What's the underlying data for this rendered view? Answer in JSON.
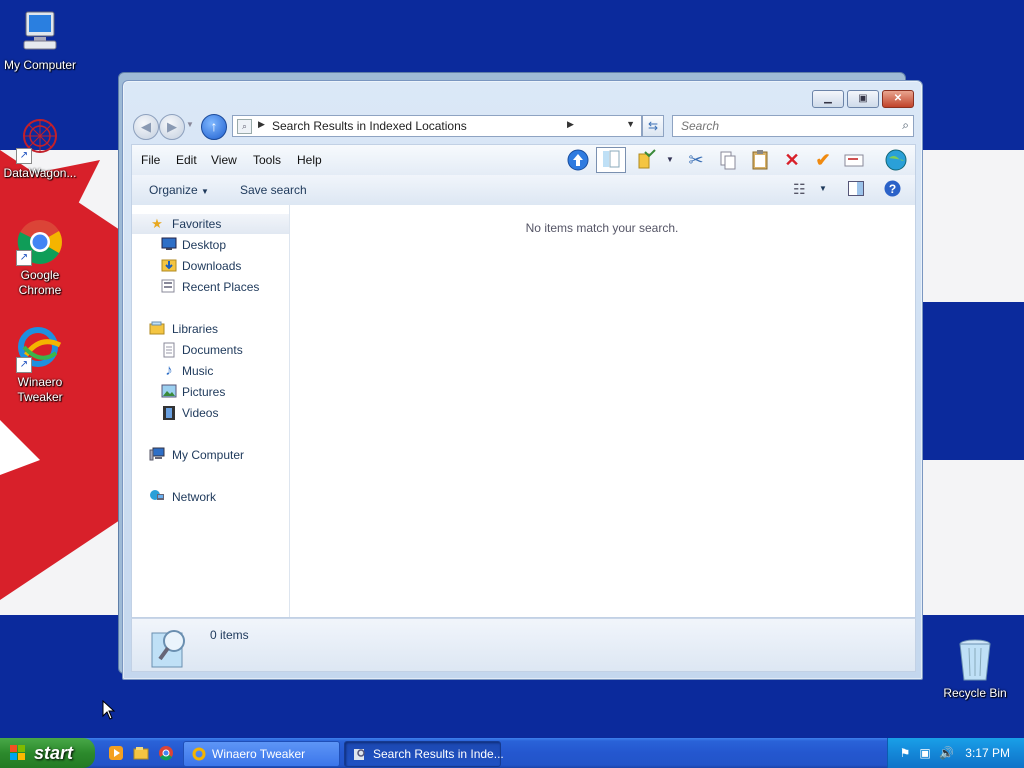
{
  "desktop": {
    "icons": [
      {
        "label": "My Computer"
      },
      {
        "label": "DataWagon..."
      },
      {
        "label": "Google Chrome"
      },
      {
        "label": "Winaero Tweaker"
      },
      {
        "label": "Recycle Bin"
      }
    ]
  },
  "window": {
    "address": {
      "crumb": "Search Results in Indexed Locations"
    },
    "search": {
      "placeholder": "Search"
    },
    "menus": [
      "File",
      "Edit",
      "View",
      "Tools",
      "Help"
    ],
    "commands": {
      "organize": "Organize",
      "save_search": "Save search"
    },
    "nav": {
      "favorites": "Favorites",
      "desktop": "Desktop",
      "downloads": "Downloads",
      "recent": "Recent Places",
      "libraries": "Libraries",
      "documents": "Documents",
      "music": "Music",
      "pictures": "Pictures",
      "videos": "Videos",
      "computer": "My Computer",
      "network": "Network"
    },
    "empty_message": "No items match your search.",
    "details": {
      "count": "0 items"
    }
  },
  "taskbar": {
    "start_label": "start",
    "tasks": [
      {
        "label": "Winaero Tweaker"
      },
      {
        "label": "Search Results in Inde..."
      }
    ],
    "clock": "3:17 PM"
  },
  "colors": {
    "flag_blue": "#0b2a9c",
    "flag_red": "#d8202a",
    "taskbar_blue": "#2457cf",
    "start_green": "#2c8a2c"
  }
}
